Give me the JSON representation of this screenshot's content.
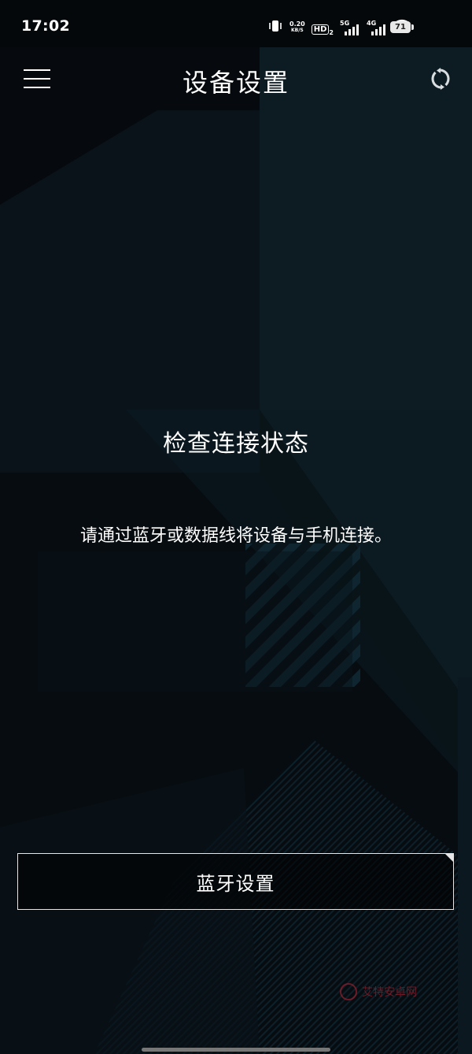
{
  "status_bar": {
    "time": "17:02",
    "net_speed_value": "0.20",
    "net_speed_unit": "KB/S",
    "hd_badge": "HD",
    "hd_sub": "2",
    "signal1_label": "5G",
    "signal2_label": "4G",
    "battery": "71",
    "icons": [
      "vibrate-icon",
      "hd-voice-icon",
      "signal-5g-icon",
      "signal-4g-icon",
      "wifi-icon",
      "battery-icon"
    ]
  },
  "header": {
    "title": "设备设置",
    "menu_icon": "hamburger-menu-icon",
    "action_icon": "refresh-icon"
  },
  "main": {
    "heading": "检查连接状态",
    "description": "请通过蓝牙或数据线将设备与手机连接。",
    "bluetooth_button": "蓝牙设置"
  },
  "watermark": {
    "text": "艾特安卓网"
  },
  "colors": {
    "background": "#05080b",
    "text": "#ffffff",
    "button_border": "#e6e6e6",
    "watermark": "#bb2233"
  }
}
